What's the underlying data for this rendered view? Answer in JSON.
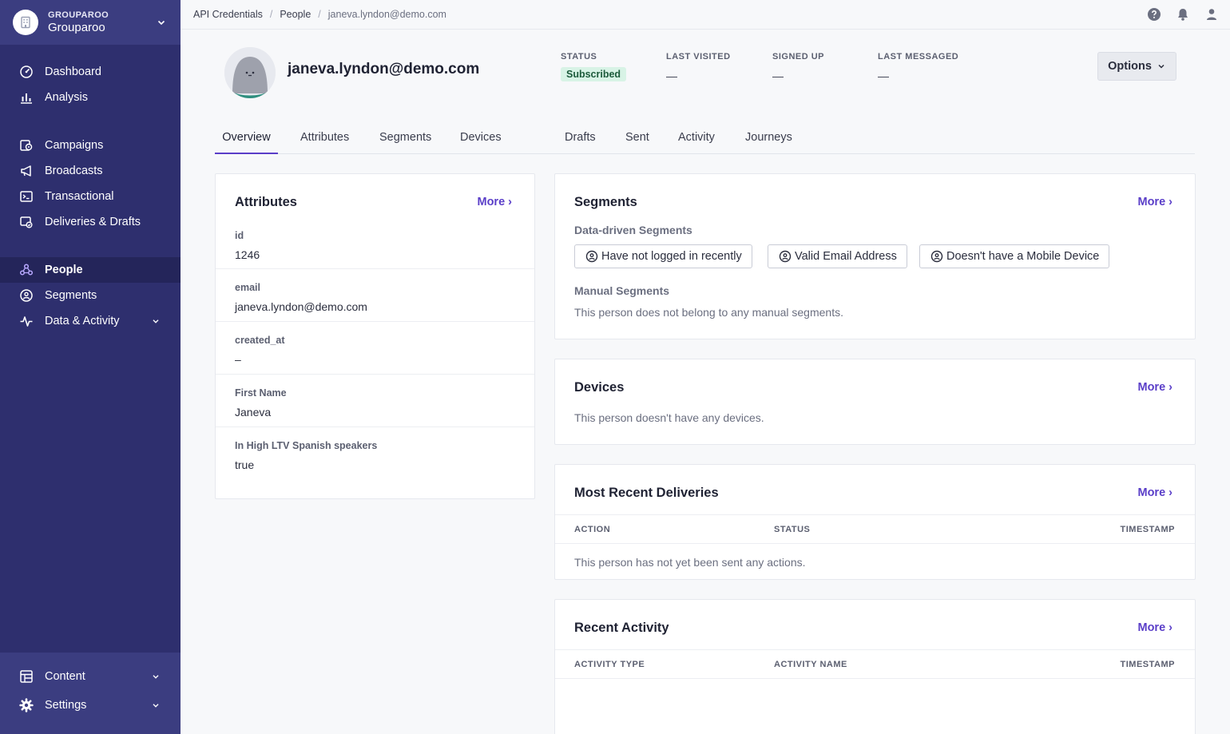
{
  "org": {
    "kicker": "GROUPAROO",
    "name": "Grouparoo"
  },
  "nav": {
    "dashboard": "Dashboard",
    "analysis": "Analysis",
    "campaigns": "Campaigns",
    "broadcasts": "Broadcasts",
    "transactional": "Transactional",
    "deliveries": "Deliveries & Drafts",
    "people": "People",
    "segments": "Segments",
    "data_activity": "Data & Activity",
    "content": "Content",
    "settings": "Settings"
  },
  "breadcrumb": [
    "API Credentials",
    "People",
    "janeva.lyndon@demo.com"
  ],
  "person": {
    "email": "janeva.lyndon@demo.com",
    "stats": [
      {
        "label": "STATUS",
        "value": "Subscribed"
      },
      {
        "label": "LAST VISITED",
        "value": "—"
      },
      {
        "label": "SIGNED UP",
        "value": "—"
      },
      {
        "label": "LAST MESSAGED",
        "value": "—"
      }
    ],
    "options_label": "Options"
  },
  "tabs": [
    "Overview",
    "Attributes",
    "Segments",
    "Devices",
    "Drafts",
    "Sent",
    "Activity",
    "Journeys"
  ],
  "attributes_card": {
    "title": "Attributes",
    "more": "More ›",
    "rows": [
      {
        "key": "id",
        "value": "1246"
      },
      {
        "key": "email",
        "value": "janeva.lyndon@demo.com"
      },
      {
        "key": "created_at",
        "value": "–"
      },
      {
        "key": "First Name",
        "value": "Janeva"
      },
      {
        "key": "In High LTV Spanish speakers",
        "value": "true"
      }
    ]
  },
  "segments_card": {
    "title": "Segments",
    "more": "More ›",
    "data_driven_heading": "Data-driven Segments",
    "chips": [
      "Have not logged in recently",
      "Valid Email Address",
      "Doesn't have a Mobile Device"
    ],
    "manual_heading": "Manual Segments",
    "manual_empty": "This person does not belong to any manual segments."
  },
  "devices_card": {
    "title": "Devices",
    "more": "More ›",
    "empty": "This person doesn't have any devices."
  },
  "deliveries_card": {
    "title": "Most Recent Deliveries",
    "more": "More ›",
    "columns": [
      "ACTION",
      "STATUS",
      "TIMESTAMP"
    ],
    "empty": "This person has not yet been sent any actions."
  },
  "activity_card": {
    "title": "Recent Activity",
    "more": "More ›",
    "columns": [
      "ACTIVITY TYPE",
      "ACTIVITY NAME",
      "TIMESTAMP"
    ]
  },
  "colors": {
    "sidebar": "#2e2f6e",
    "accent": "#5a3ec8",
    "badge_bg": "#d8f3e6"
  }
}
